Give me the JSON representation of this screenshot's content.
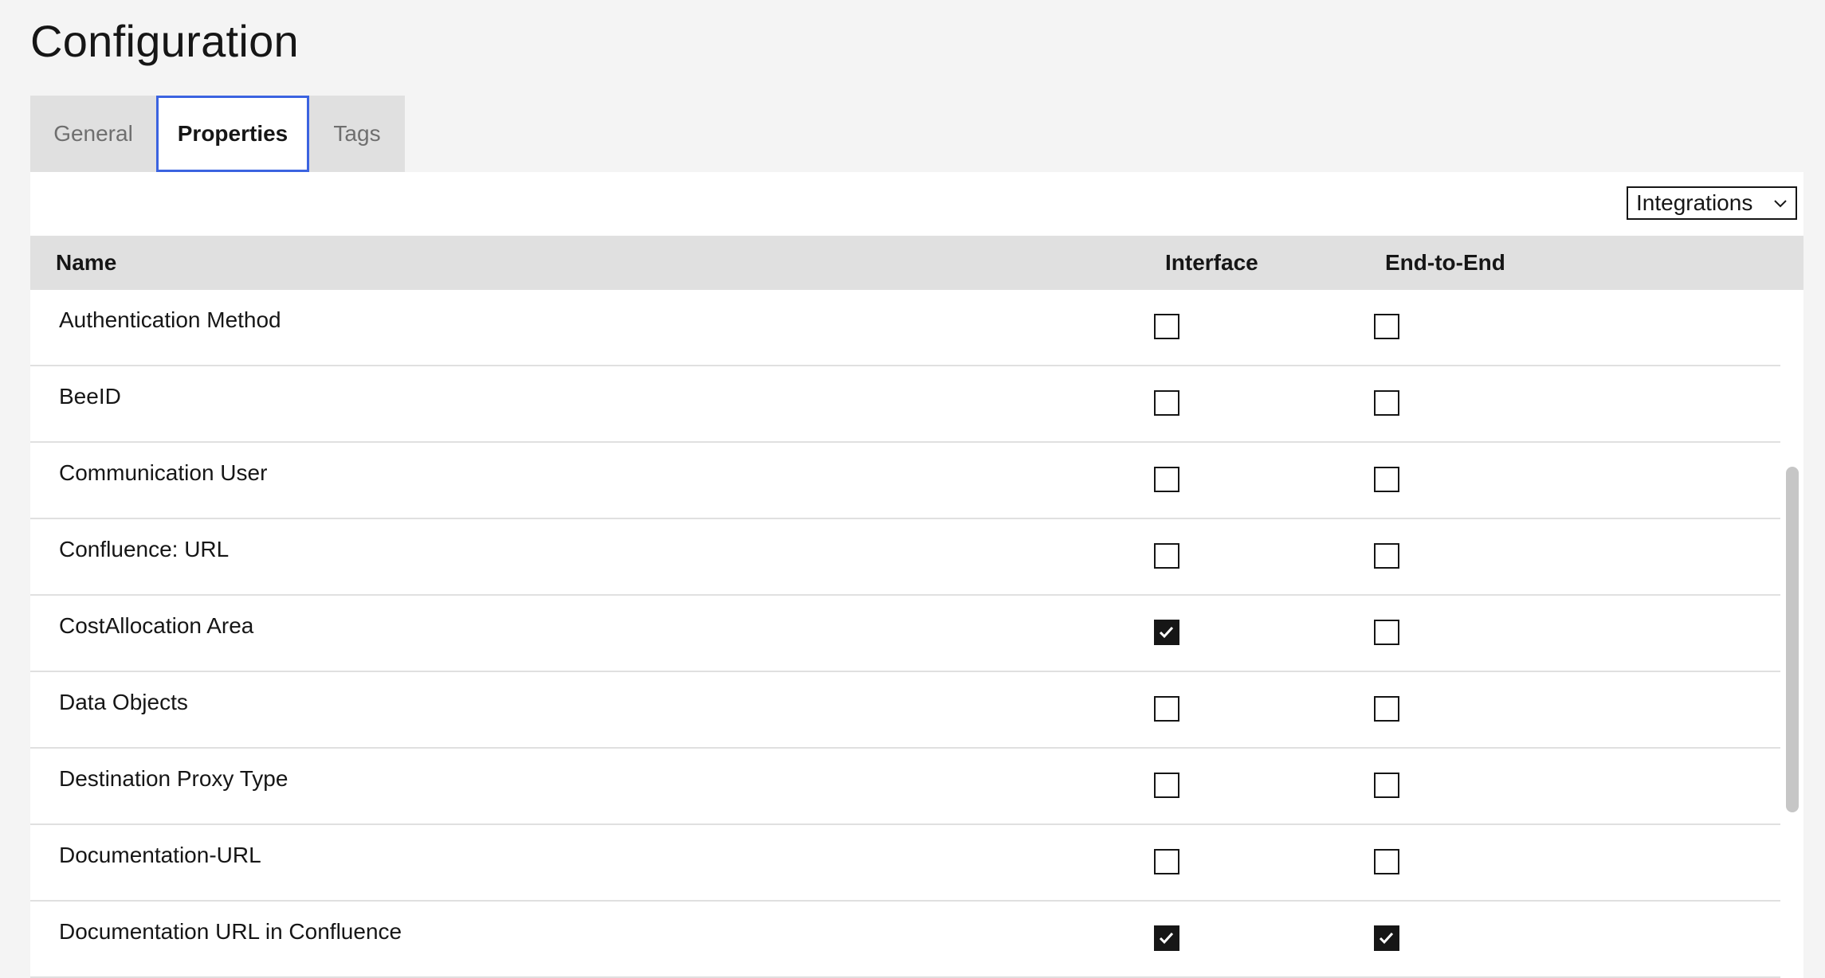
{
  "page": {
    "title": "Configuration"
  },
  "tabs": [
    {
      "label": "General",
      "selected": false
    },
    {
      "label": "Properties",
      "selected": true
    },
    {
      "label": "Tags",
      "selected": false
    }
  ],
  "filter": {
    "selected": "Integrations",
    "icon": "chevron-down-icon"
  },
  "table": {
    "columns": [
      "Name",
      "Interface",
      "End-to-End"
    ],
    "rows": [
      {
        "name": "Authentication Method",
        "interface": false,
        "end_to_end": false
      },
      {
        "name": "BeeID",
        "interface": false,
        "end_to_end": false
      },
      {
        "name": "Communication User",
        "interface": false,
        "end_to_end": false
      },
      {
        "name": "Confluence: URL",
        "interface": false,
        "end_to_end": false
      },
      {
        "name": "CostAllocation Area",
        "interface": true,
        "end_to_end": false
      },
      {
        "name": "Data Objects",
        "interface": false,
        "end_to_end": false
      },
      {
        "name": "Destination Proxy Type",
        "interface": false,
        "end_to_end": false
      },
      {
        "name": "Documentation-URL",
        "interface": false,
        "end_to_end": false
      },
      {
        "name": "Documentation URL in Confluence",
        "interface": true,
        "end_to_end": true
      }
    ]
  },
  "colors": {
    "accent": "#3b63e0",
    "checked": "#161616",
    "header_bg": "#e0e0e0",
    "page_bg": "#f4f4f4"
  }
}
